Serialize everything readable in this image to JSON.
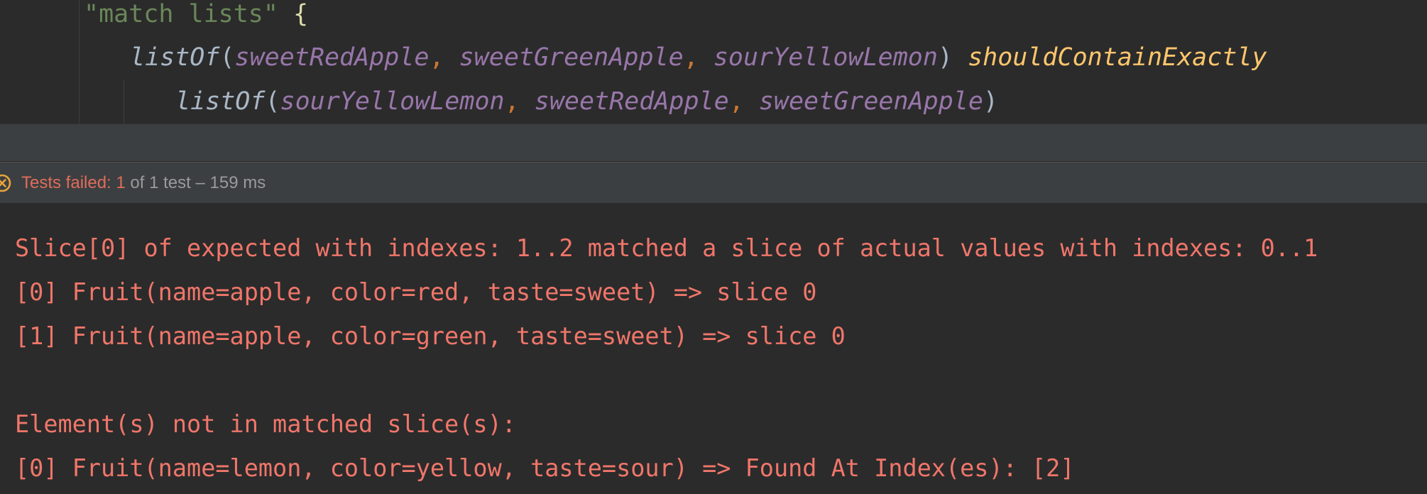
{
  "editor": {
    "line1": {
      "string": "\"match lists\"",
      "brace": "{"
    },
    "line2": {
      "fn": "listOf",
      "open": "(",
      "arg1": "sweetRedApple",
      "arg2": "sweetGreenApple",
      "arg3": "sourYellowLemon",
      "close": ")",
      "infix": "shouldContainExactly"
    },
    "line3": {
      "fn": "listOf",
      "open": "(",
      "arg1": "sourYellowLemon",
      "arg2": "sweetRedApple",
      "arg3": "sweetGreenApple",
      "close": ")"
    },
    "comma": ","
  },
  "status": {
    "prefix": "Tests failed: ",
    "failed_count": "1",
    "rest": " of 1 test – 159 ms",
    "icon": "error-circle-icon"
  },
  "console": {
    "lines": [
      "Slice[0] of expected with indexes: 1..2 matched a slice of actual values with indexes: 0..1",
      "[0] Fruit(name=apple, color=red, taste=sweet) => slice 0",
      "[1] Fruit(name=apple, color=green, taste=sweet) => slice 0",
      "Element(s) not in matched slice(s):",
      "[0] Fruit(name=lemon, color=yellow, taste=sour) => Found At Index(es): [2]"
    ]
  },
  "colors": {
    "editor_bg": "#2b2b2b",
    "string": "#6a8759",
    "variable": "#9876aa",
    "function_infix": "#ffc66d",
    "error_text": "#f0766a",
    "status_bg": "#3c3f41"
  }
}
